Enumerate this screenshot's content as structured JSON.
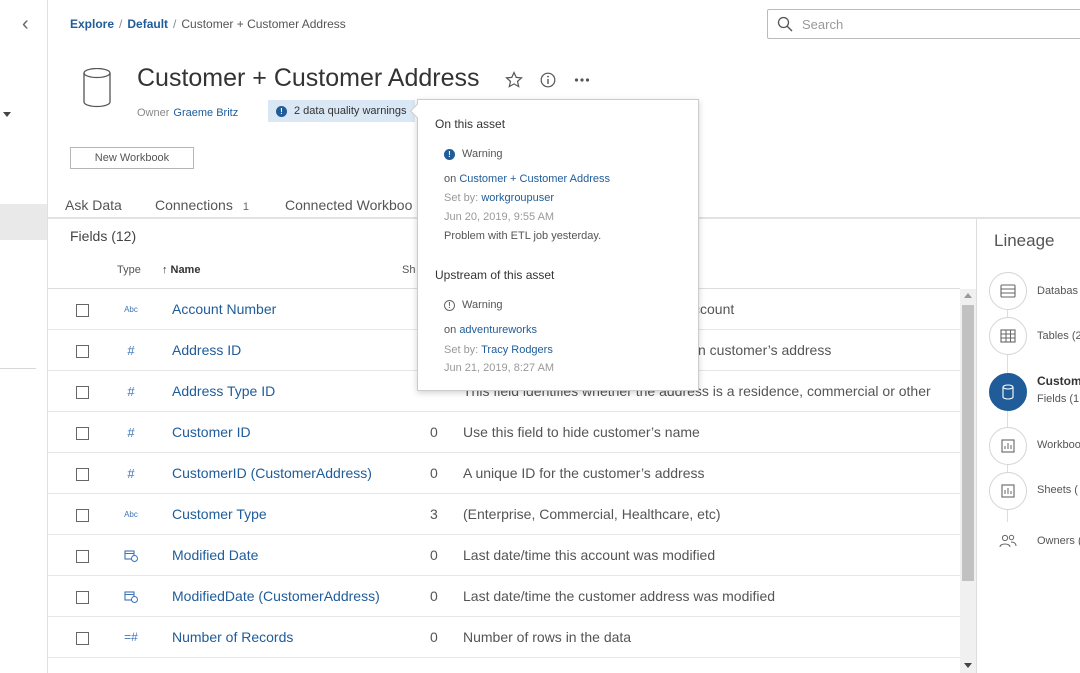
{
  "breadcrumb": {
    "items": [
      {
        "label": "Explore"
      },
      {
        "label": "Default"
      },
      {
        "label": "Customer + Customer Address"
      }
    ]
  },
  "search": {
    "placeholder": "Search"
  },
  "header": {
    "title": "Customer + Customer Address",
    "owner_label": "Owner",
    "owner_name": "Graeme Britz",
    "dq_badge": "2 data quality warnings",
    "icons": [
      "star-icon",
      "info-icon",
      "more-icon"
    ]
  },
  "actions": {
    "new_workbook": "New Workbook"
  },
  "tabs": [
    {
      "label": "Ask Data",
      "count": ""
    },
    {
      "label": "Connections",
      "count": "1"
    },
    {
      "label": "Connected Workboo",
      "count": ""
    }
  ],
  "fields": {
    "title": "Fields (12)",
    "columns": {
      "type": "Type",
      "name": "Name",
      "sort_arrow": "↑",
      "sheets": "Sh"
    },
    "rows": [
      {
        "type_icon": "abc-icon",
        "name": "Account Number",
        "count": "",
        "desc": "ccount"
      },
      {
        "type_icon": "hash-icon",
        "name": "Address ID",
        "count": "",
        "desc": "n customer’s address"
      },
      {
        "type_icon": "hash-icon",
        "name": "Address Type ID",
        "count": "",
        "desc": "This field identifies whether the address is a residence, commercial or other"
      },
      {
        "type_icon": "hash-icon",
        "name": "Customer ID",
        "count": "0",
        "desc": "Use this field to hide customer’s name"
      },
      {
        "type_icon": "hash-icon",
        "name": "CustomerID (CustomerAddress)",
        "count": "0",
        "desc": "A unique ID for the customer’s address"
      },
      {
        "type_icon": "abc-icon",
        "name": "Customer Type",
        "count": "3",
        "desc": "(Enterprise, Commercial, Healthcare, etc)"
      },
      {
        "type_icon": "date-icon",
        "name": "Modified Date",
        "count": "0",
        "desc": "Last date/time this account was modified"
      },
      {
        "type_icon": "date-icon",
        "name": "ModifiedDate (CustomerAddress)",
        "count": "0",
        "desc": "Last date/time the customer address was modified"
      },
      {
        "type_icon": "calc-hash-icon",
        "name": "Number of Records",
        "count": "0",
        "desc": "Number of rows in the data"
      }
    ]
  },
  "lineage": {
    "title": "Lineage",
    "nodes": [
      {
        "icon": "database-icon",
        "label": "Databas",
        "sub": ""
      },
      {
        "icon": "table-icon",
        "label": "Tables (2",
        "sub": ""
      },
      {
        "icon": "datasource-icon",
        "label": "Custom",
        "sub": "Fields (1"
      },
      {
        "icon": "workbook-icon",
        "label": "Workboo",
        "sub": ""
      },
      {
        "icon": "sheet-icon",
        "label": "Sheets (",
        "sub": ""
      },
      {
        "icon": "owners-icon",
        "label": "Owners (",
        "sub": ""
      }
    ]
  },
  "popover": {
    "asset_heading": "On this asset",
    "asset_warning": {
      "label": "Warning",
      "on_prefix": "on",
      "on_link": "Customer + Customer Address",
      "set_by_prefix": "Set by:",
      "set_by": "workgroupuser",
      "date": "Jun 20, 2019, 9:55 AM",
      "message": "Problem with ETL job yesterday."
    },
    "upstream_heading": "Upstream of this asset",
    "upstream_warning": {
      "label": "Warning",
      "on_prefix": "on",
      "on_link": "adventureworks",
      "set_by_prefix": "Set by:",
      "set_by": "Tracy Rodgers",
      "date": "Jun 21, 2019, 8:27 AM"
    }
  },
  "colors": {
    "link": "#1f5c99",
    "accent": "#1f5c99",
    "badge_bg": "#dae7f5",
    "scroll_thumb": "#c1c1c1"
  }
}
